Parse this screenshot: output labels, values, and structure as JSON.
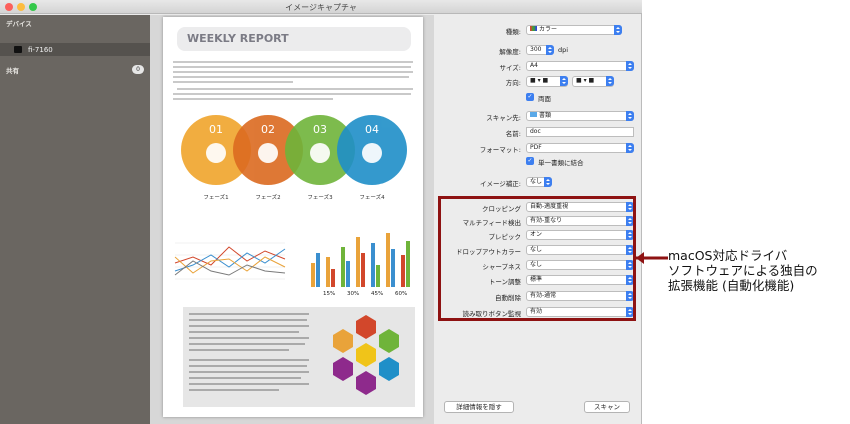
{
  "window": {
    "title": "イメージキャプチャ"
  },
  "sidebar": {
    "devices_header": "デバイス",
    "device_name": "fi-7160",
    "shared_header": "共有",
    "shared_count": "0"
  },
  "report": {
    "title": "WEEKLY REPORT",
    "phases": [
      {
        "num": "01",
        "label": "フェーズ1",
        "color": "#33a2cf"
      },
      {
        "num": "02",
        "label": "フェーズ2",
        "color": "#de7b26"
      },
      {
        "num": "03",
        "label": "フェーズ3",
        "color": "#8fbe3f"
      },
      {
        "num": "04",
        "label": "フェーズ4",
        "color": "#2b8fc7"
      }
    ],
    "percents": [
      "15%",
      "30%",
      "45%",
      "60%"
    ]
  },
  "settings": {
    "kind": {
      "label": "種類:",
      "value": "カラー"
    },
    "resolution": {
      "label": "解像度:",
      "value": "300",
      "unit": "dpi"
    },
    "size": {
      "label": "サイズ:",
      "value": "A4"
    },
    "orientation": {
      "label": "方向:"
    },
    "duplex": {
      "label": "両面"
    },
    "scan_to": {
      "label": "スキャン先:",
      "value": "書類"
    },
    "name": {
      "label": "名前:",
      "value": "doc"
    },
    "format": {
      "label": "フォーマット:",
      "value": "PDF"
    },
    "combine": {
      "label": "単一書類に結合"
    },
    "image_correction": {
      "label": "イメージ補正:",
      "value": "なし"
    },
    "cropping": {
      "label": "クロッピング",
      "value": "自動-適度重視"
    },
    "multifeed": {
      "label": "マルチフィード検出",
      "value": "有効-重なり"
    },
    "prepick": {
      "label": "プレピック",
      "value": "オン"
    },
    "dropout": {
      "label": "ドロップアウトカラー",
      "value": "なし"
    },
    "sharpness": {
      "label": "シャープネス",
      "value": "なし"
    },
    "tone": {
      "label": "トーン調整",
      "value": "標準"
    },
    "auto_delete": {
      "label": "自動削除",
      "value": "有効-通常"
    },
    "button_monitor": {
      "label": "読み取りボタン監視",
      "value": "有効"
    }
  },
  "buttons": {
    "hide_details": "詳細情報を隠す",
    "scan": "スキャン"
  },
  "callout": {
    "line1": "macOS対応ドライバ",
    "line2": "ソフトウェアによる独自の",
    "line3": "拡張機能 (自動化機能)"
  },
  "colors": {
    "highlight": "#8e1212",
    "accent": "#3d7ff0"
  }
}
